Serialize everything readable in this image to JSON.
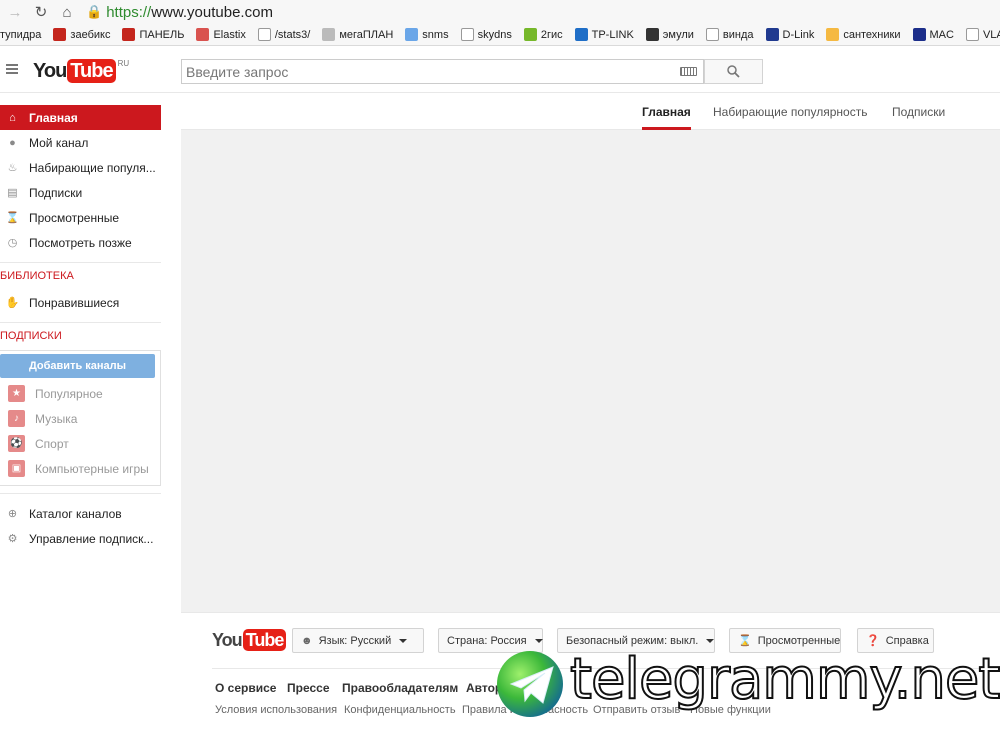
{
  "browser": {
    "url_scheme": "https://",
    "url_rest": "www.youtube.com",
    "bookmarks": [
      {
        "label": "тупидра",
        "color": "#ffffff"
      },
      {
        "label": "заебикс",
        "color": "#c4261d"
      },
      {
        "label": "ПАНЕЛЬ",
        "color": "#c4261d"
      },
      {
        "label": "Elastix",
        "color": "#d9534f"
      },
      {
        "label": "/stats3/",
        "color": "#ffffff"
      },
      {
        "label": "мегаПЛАН",
        "color": "#bbbbbb"
      },
      {
        "label": "snms",
        "color": "#6aa6e8"
      },
      {
        "label": "skydns",
        "color": "#ffffff"
      },
      {
        "label": "2гис",
        "color": "#76b82a"
      },
      {
        "label": "TP-LINK",
        "color": "#1f6ec7"
      },
      {
        "label": "эмули",
        "color": "#333333"
      },
      {
        "label": "винда",
        "color": "#ffffff"
      },
      {
        "label": "D-Link",
        "color": "#203a8f"
      },
      {
        "label": "сантехники",
        "color": "#f5b942"
      },
      {
        "label": "MAC",
        "color": "#1c2e8a"
      },
      {
        "label": "VLAN",
        "color": "#ffffff"
      }
    ]
  },
  "header": {
    "logo_you": "You",
    "logo_tube": "Tube",
    "logo_region": "RU",
    "search_placeholder": "Введите запрос"
  },
  "sidebar": {
    "main_items": [
      {
        "label": "Главная",
        "icon": "home-icon",
        "active": true
      },
      {
        "label": "Мой канал",
        "icon": "user-icon",
        "active": false
      },
      {
        "label": "Набирающие популя...",
        "icon": "flame-icon",
        "active": false
      },
      {
        "label": "Подписки",
        "icon": "subscriptions-icon",
        "active": false
      },
      {
        "label": "Просмотренные",
        "icon": "hourglass-icon",
        "active": false
      },
      {
        "label": "Посмотреть позже",
        "icon": "clock-icon",
        "active": false
      }
    ],
    "library_title": "БИБЛИОТЕКА",
    "library_items": [
      {
        "label": "Понравившиеся",
        "icon": "thumbs-up-icon"
      }
    ],
    "subscriptions_title": "ПОДПИСКИ",
    "add_channels_label": "Добавить каналы",
    "suggested": [
      {
        "label": "Популярное",
        "icon": "star-icon"
      },
      {
        "label": "Музыка",
        "icon": "music-note-icon"
      },
      {
        "label": "Спорт",
        "icon": "ball-icon"
      },
      {
        "label": "Компьютерные игры",
        "icon": "gamepad-icon"
      }
    ],
    "bottom_items": [
      {
        "label": "Каталог каналов",
        "icon": "plus-circle-icon"
      },
      {
        "label": "Управление подписк...",
        "icon": "gear-icon"
      }
    ]
  },
  "tabs": [
    {
      "label": "Главная",
      "active": true
    },
    {
      "label": "Набирающие популярность",
      "active": false
    },
    {
      "label": "Подписки",
      "active": false
    }
  ],
  "footer": {
    "logo_you": "You",
    "logo_tube": "Tube",
    "language_label": "Язык: Русский",
    "country_label": "Страна: Россия",
    "safe_mode_label": "Безопасный режим: выкл.",
    "history_label": "Просмотренные",
    "help_label": "Справка",
    "links_primary": [
      "О сервисе",
      "Прессе",
      "Правообладателям",
      "Авторам"
    ],
    "links_secondary": [
      "Условия использования",
      "Конфиденциальность",
      "Правила и безопасность",
      "Отправить отзыв",
      "Новые функции"
    ]
  },
  "watermark": {
    "text": "telegrammy.net"
  },
  "colors": {
    "brand_red": "#cc181e",
    "accent_blue": "#7eb0e0",
    "content_bg": "#f1f1f1"
  }
}
